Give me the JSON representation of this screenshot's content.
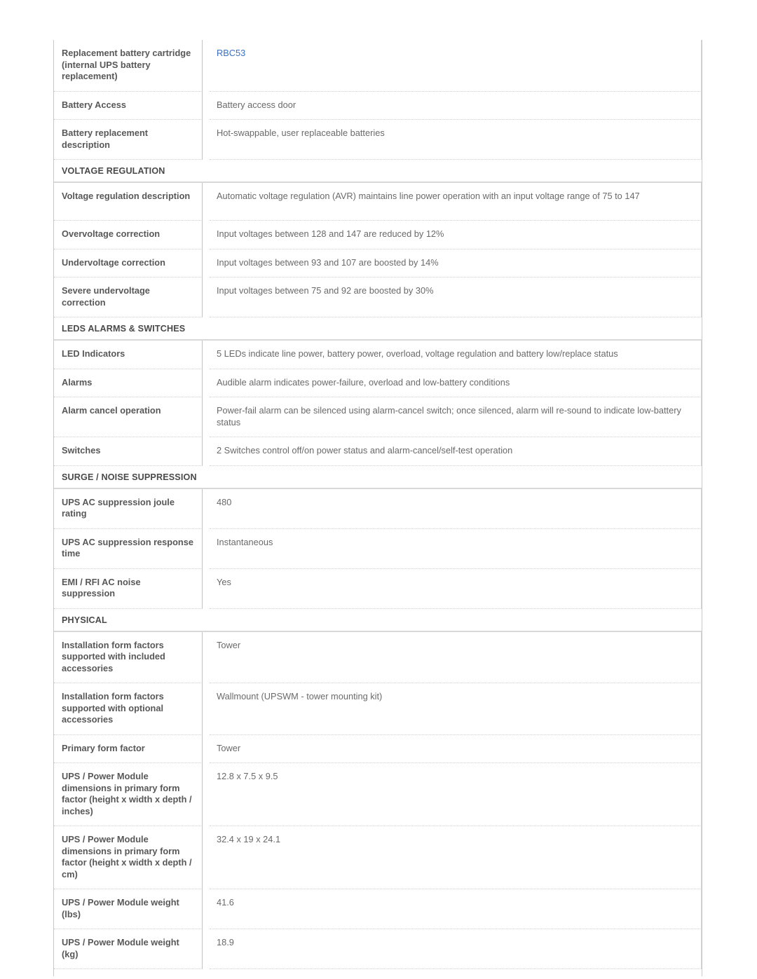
{
  "document": {
    "type": "specification-table",
    "link_color": "#3a6fc4",
    "label_color": "#585858",
    "value_color": "#6a6a6a"
  },
  "rows": [
    {
      "kind": "spec",
      "size": "xtall",
      "label": "Replacement battery cartridge (internal UPS battery replacement)",
      "value": "RBC53",
      "is_link": true
    },
    {
      "kind": "spec",
      "size": "short",
      "label": "Battery Access",
      "value": "Battery access door",
      "is_link": false
    },
    {
      "kind": "spec",
      "size": "tall",
      "label": "Battery replacement description",
      "value": "Hot-swappable, user replaceable batteries",
      "is_link": false
    },
    {
      "kind": "section",
      "label": "VOLTAGE REGULATION"
    },
    {
      "kind": "spec",
      "size": "tall",
      "label": "Voltage regulation description",
      "value": "Automatic voltage regulation (AVR) maintains line power operation with an input voltage range of 75 to 147",
      "is_link": false
    },
    {
      "kind": "spec",
      "size": "short",
      "label": "Overvoltage correction",
      "value": "Input voltages between 128 and 147 are reduced by 12%",
      "is_link": false
    },
    {
      "kind": "spec",
      "size": "short",
      "label": "Undervoltage correction",
      "value": "Input voltages between 93 and 107 are boosted by 14%",
      "is_link": false
    },
    {
      "kind": "spec",
      "size": "tall",
      "label": "Severe undervoltage correction",
      "value": "Input voltages between 75 and 92 are boosted by 30%",
      "is_link": false
    },
    {
      "kind": "section",
      "label": "LEDS ALARMS & SWITCHES"
    },
    {
      "kind": "spec",
      "size": "short",
      "label": "LED Indicators",
      "value": "5 LEDs indicate line power, battery power, overload, voltage regulation and battery low/replace status",
      "is_link": false
    },
    {
      "kind": "spec",
      "size": "short",
      "label": "Alarms",
      "value": "Audible alarm indicates power-failure, overload and low-battery conditions",
      "is_link": false
    },
    {
      "kind": "spec",
      "size": "tall",
      "label": "Alarm cancel operation",
      "value": "Power-fail alarm can be silenced using alarm-cancel switch; once silenced, alarm will re-sound to indicate low-battery status",
      "is_link": false
    },
    {
      "kind": "spec",
      "size": "short",
      "label": "Switches",
      "value": "2 Switches control off/on power status and alarm-cancel/self-test operation",
      "is_link": false
    },
    {
      "kind": "section",
      "label": "SURGE / NOISE SUPPRESSION"
    },
    {
      "kind": "spec",
      "size": "tall",
      "label": "UPS AC suppression joule rating",
      "value": "480",
      "is_link": false
    },
    {
      "kind": "spec",
      "size": "tall",
      "label": "UPS AC suppression response time",
      "value": "Instantaneous",
      "is_link": false
    },
    {
      "kind": "spec",
      "size": "tall",
      "label": "EMI / RFI AC noise suppression",
      "value": "Yes",
      "is_link": false
    },
    {
      "kind": "section",
      "label": "PHYSICAL"
    },
    {
      "kind": "spec",
      "size": "xtall",
      "label": "Installation form factors supported with included accessories",
      "value": "Tower",
      "is_link": false
    },
    {
      "kind": "spec",
      "size": "xtall",
      "label": "Installation form factors supported with optional accessories",
      "value": "Wallmount (UPSWM - tower mounting kit)",
      "is_link": false
    },
    {
      "kind": "spec",
      "size": "short",
      "label": "Primary form factor",
      "value": "Tower",
      "is_link": false
    },
    {
      "kind": "spec",
      "size": "xxtall",
      "label": "UPS / Power Module dimensions in primary form factor (height x width x depth / inches)",
      "value": "12.8 x 7.5 x 9.5",
      "is_link": false
    },
    {
      "kind": "spec",
      "size": "xxtall",
      "label": "UPS / Power Module dimensions in primary form factor (height x width x depth / cm)",
      "value": "32.4 x 19 x 24.1",
      "is_link": false
    },
    {
      "kind": "spec",
      "size": "tall",
      "label": "UPS / Power Module weight (lbs)",
      "value": "41.6",
      "is_link": false
    },
    {
      "kind": "spec",
      "size": "tall",
      "label": "UPS / Power Module weight (kg)",
      "value": "18.9",
      "is_link": false
    }
  ]
}
